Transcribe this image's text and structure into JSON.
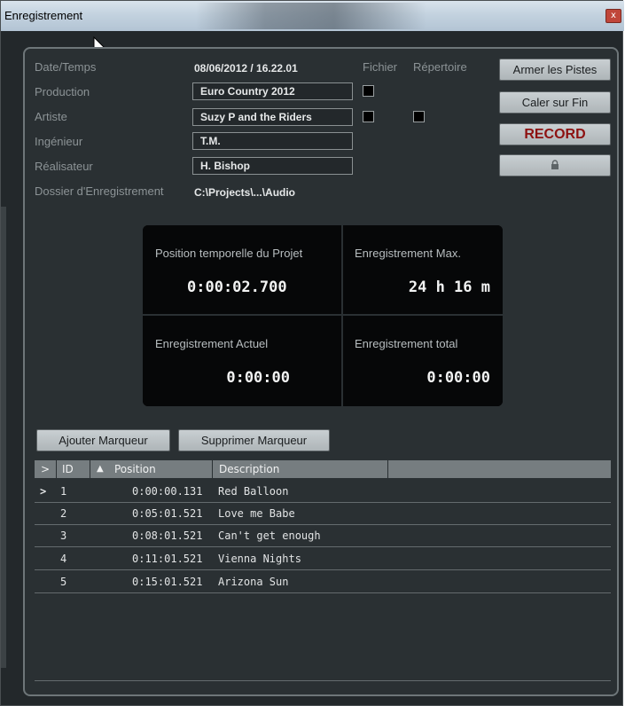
{
  "window": {
    "title": "Enregistrement",
    "close_glyph": "x"
  },
  "fields": {
    "date_label": "Date/Temps",
    "date_value": "08/06/2012  /  16.22.01",
    "production_label": "Production",
    "production_value": "Euro Country 2012",
    "artiste_label": "Artiste",
    "artiste_value": "Suzy P and the Riders",
    "ingenieur_label": "Ingénieur",
    "ingenieur_value": "T.M.",
    "realisateur_label": "Réalisateur",
    "realisateur_value": "H. Bishop",
    "dossier_label": "Dossier d'Enregistrement",
    "dossier_value": "C:\\Projects\\...\\Audio",
    "fichier_label": "Fichier",
    "repertoire_label": "Répertoire"
  },
  "buttons": {
    "armer": "Armer les Pistes",
    "caler": "Caler sur Fin",
    "record": "RECORD",
    "lock_icon": "lock-icon"
  },
  "stats": {
    "position_label": "Position temporelle du Projet",
    "position_value": "0:00:02.700",
    "max_label": "Enregistrement Max.",
    "max_value": "24 h 16 m",
    "actuel_label": "Enregistrement Actuel",
    "actuel_value": "0:00:00",
    "total_label": "Enregistrement total",
    "total_value": "0:00:00"
  },
  "markers": {
    "add_button": "Ajouter Marqueur",
    "remove_button": "Supprimer Marqueur",
    "columns": {
      "sel": ">",
      "id": "ID",
      "sort": "▲",
      "position": "Position",
      "description": "Description"
    },
    "rows": [
      {
        "sel": ">",
        "id": "1",
        "position": "0:00:00.131",
        "description": "Red Balloon"
      },
      {
        "sel": "",
        "id": "2",
        "position": "0:05:01.521",
        "description": "Love me Babe"
      },
      {
        "sel": "",
        "id": "3",
        "position": "0:08:01.521",
        "description": "Can't get enough"
      },
      {
        "sel": "",
        "id": "4",
        "position": "0:11:01.521",
        "description": "Vienna Nights"
      },
      {
        "sel": "",
        "id": "5",
        "position": "0:15:01.521",
        "description": "Arizona Sun"
      }
    ]
  }
}
